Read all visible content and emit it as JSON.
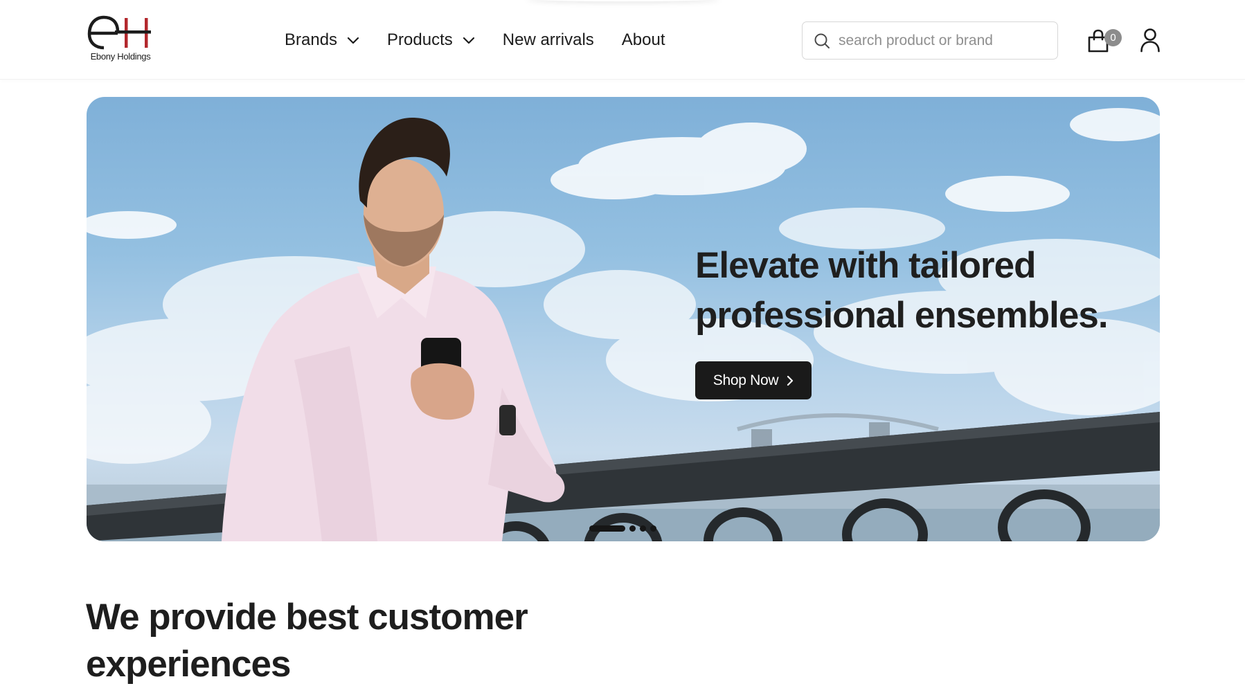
{
  "brand": {
    "logo_letters": "eH",
    "name": "Ebony Holdings",
    "accent_color": "#b3282d"
  },
  "nav": {
    "items": [
      {
        "label": "Brands",
        "has_dropdown": true,
        "icon": "chevron-down-icon"
      },
      {
        "label": "Products",
        "has_dropdown": true,
        "icon": "chevron-down-icon"
      },
      {
        "label": "New arrivals",
        "has_dropdown": false
      },
      {
        "label": "About",
        "has_dropdown": false
      }
    ]
  },
  "search": {
    "placeholder": "search product or brand",
    "icon": "search-icon"
  },
  "cart": {
    "icon": "shopping-bag-icon",
    "count": "0"
  },
  "account": {
    "icon": "user-icon"
  },
  "hero": {
    "title": "Elevate with tailored professional ensembles.",
    "cta_label": "Shop Now",
    "cta_icon": "chevron-right-icon",
    "slide_count": 4,
    "active_slide": 1,
    "image_subject": "man in pink shirt holding phone on bridge"
  },
  "section": {
    "title": "We provide best customer experiences"
  },
  "colors": {
    "text": "#1c1c1c",
    "button_bg": "#1a1a1a",
    "badge_bg": "#8c8c8c"
  }
}
